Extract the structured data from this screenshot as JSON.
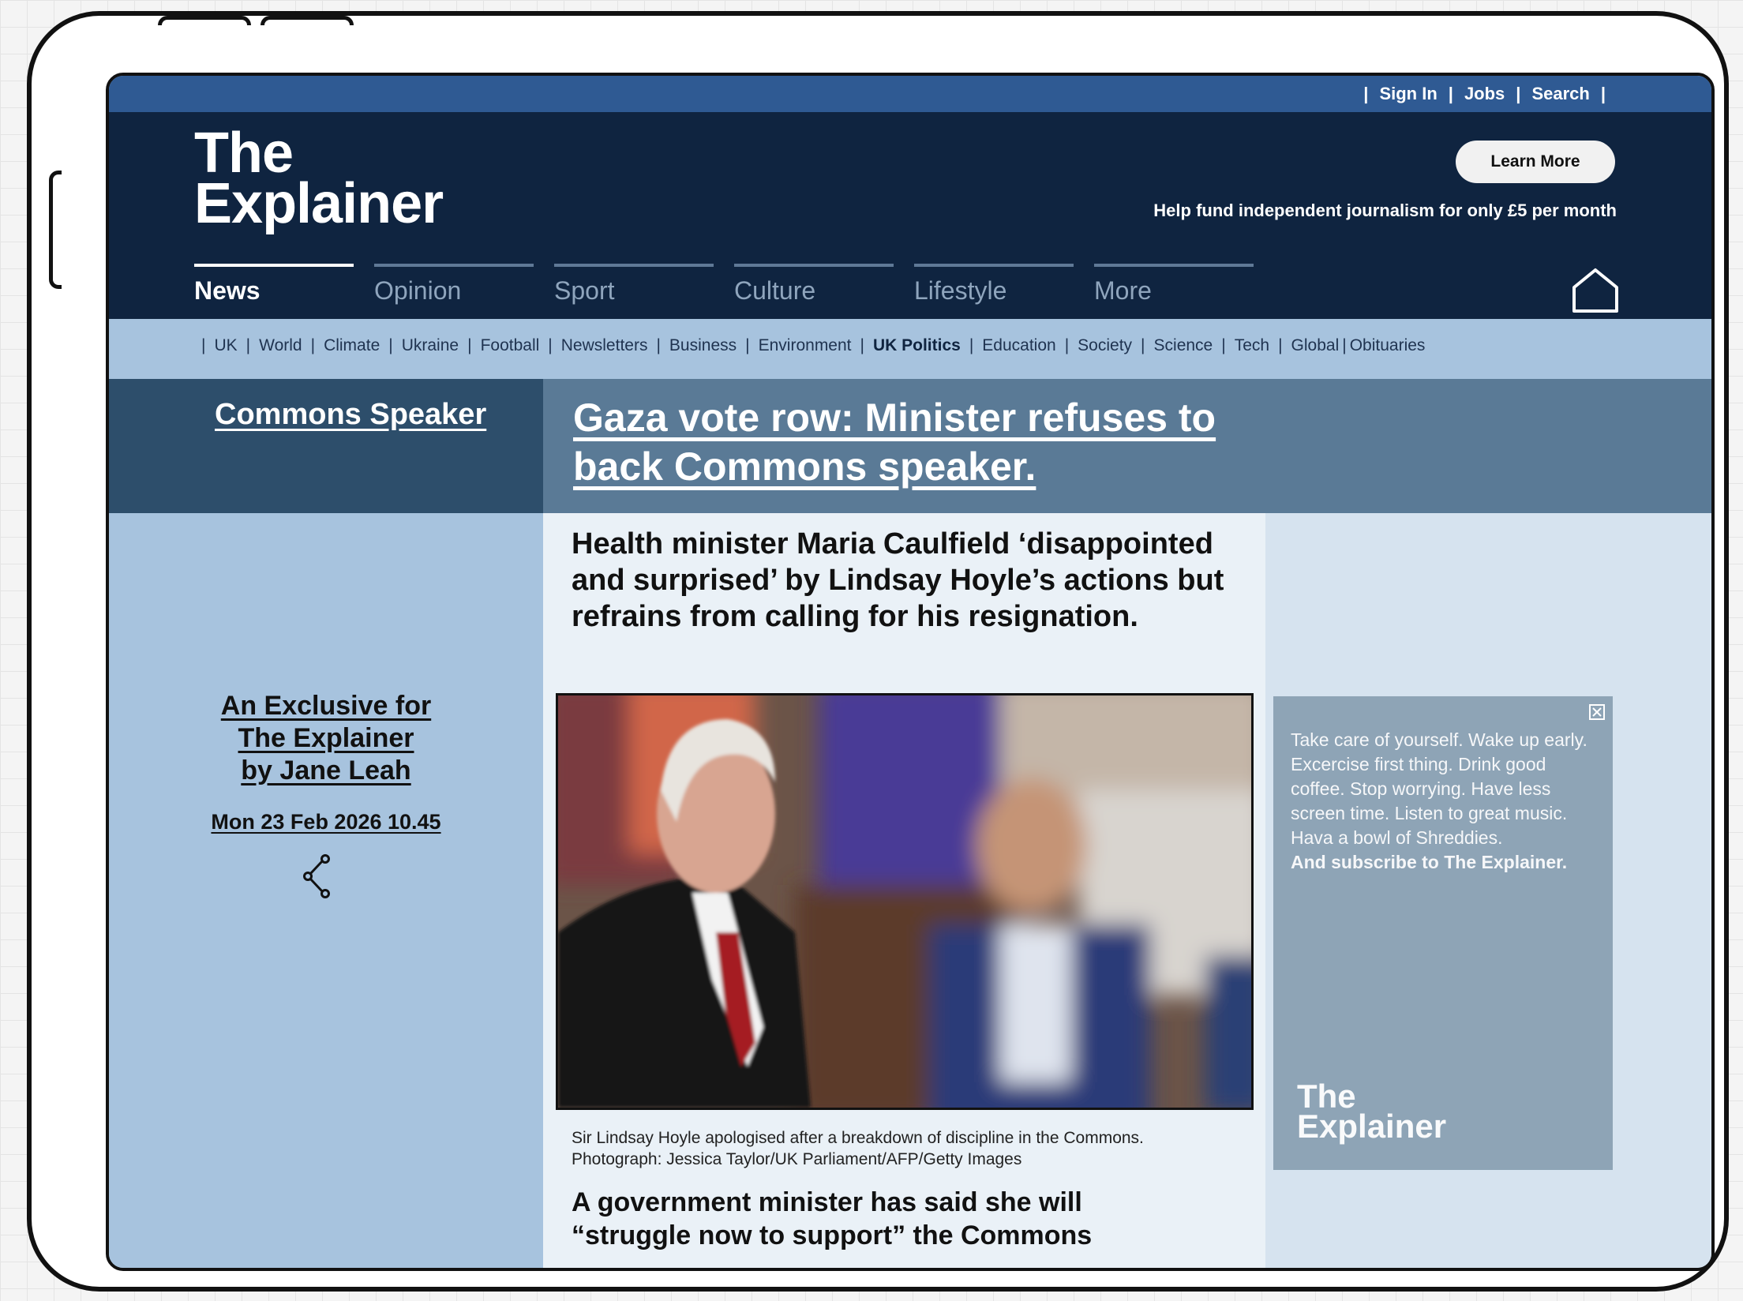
{
  "topbar": {
    "links": [
      "Sign In",
      "Jobs",
      "Search"
    ]
  },
  "header": {
    "logo_line1": "The",
    "logo_line2": "Explainer",
    "learn_more": "Learn More",
    "fund_text": "Help fund independent journalism for only £5 per month"
  },
  "tabs": [
    "News",
    "Opinion",
    "Sport",
    "Culture",
    "Lifestyle",
    "More"
  ],
  "subnav": [
    "UK",
    "World",
    "Climate",
    "Ukraine",
    "Football",
    "Newsletters",
    "Business",
    "Environment",
    "UK Politics",
    "Education",
    "Society",
    "Science",
    "Tech",
    "Global",
    "Obituaries"
  ],
  "article": {
    "section": "Commons Speaker",
    "headline": "Gaza vote row: Minister refuses to back Commons speaker.",
    "standfirst": "Health minister Maria Caulfield ‘disappointed and surprised’ by Lindsay Hoyle’s actions but refrains from calling for his resignation.",
    "byline_1": "An Exclusive for",
    "byline_2": "The Explainer",
    "byline_3": "by Jane Leah",
    "date": "Mon 23 Feb 2026 10.45",
    "caption": "Sir Lindsay Hoyle apologised after a breakdown of discipline in the Commons. Photograph: Jessica Taylor/UK Parliament/AFP/Getty Images",
    "body": "A government minister has said she will “struggle now to support” the Commons"
  },
  "ad": {
    "text": "Take care of yourself. Wake up early. Excercise first thing. Drink good coffee. Stop worrying. Have less screen time. Listen to great music. Hava a bowl of Shreddies.",
    "cta": "And subscribe to The Explainer.",
    "logo_line1": "The",
    "logo_line2": "Explainer"
  },
  "colors": {
    "navy": "#0f2440",
    "topbar": "#2f5a93",
    "light_blue": "#a7c3de",
    "band": "#5a7a96"
  }
}
